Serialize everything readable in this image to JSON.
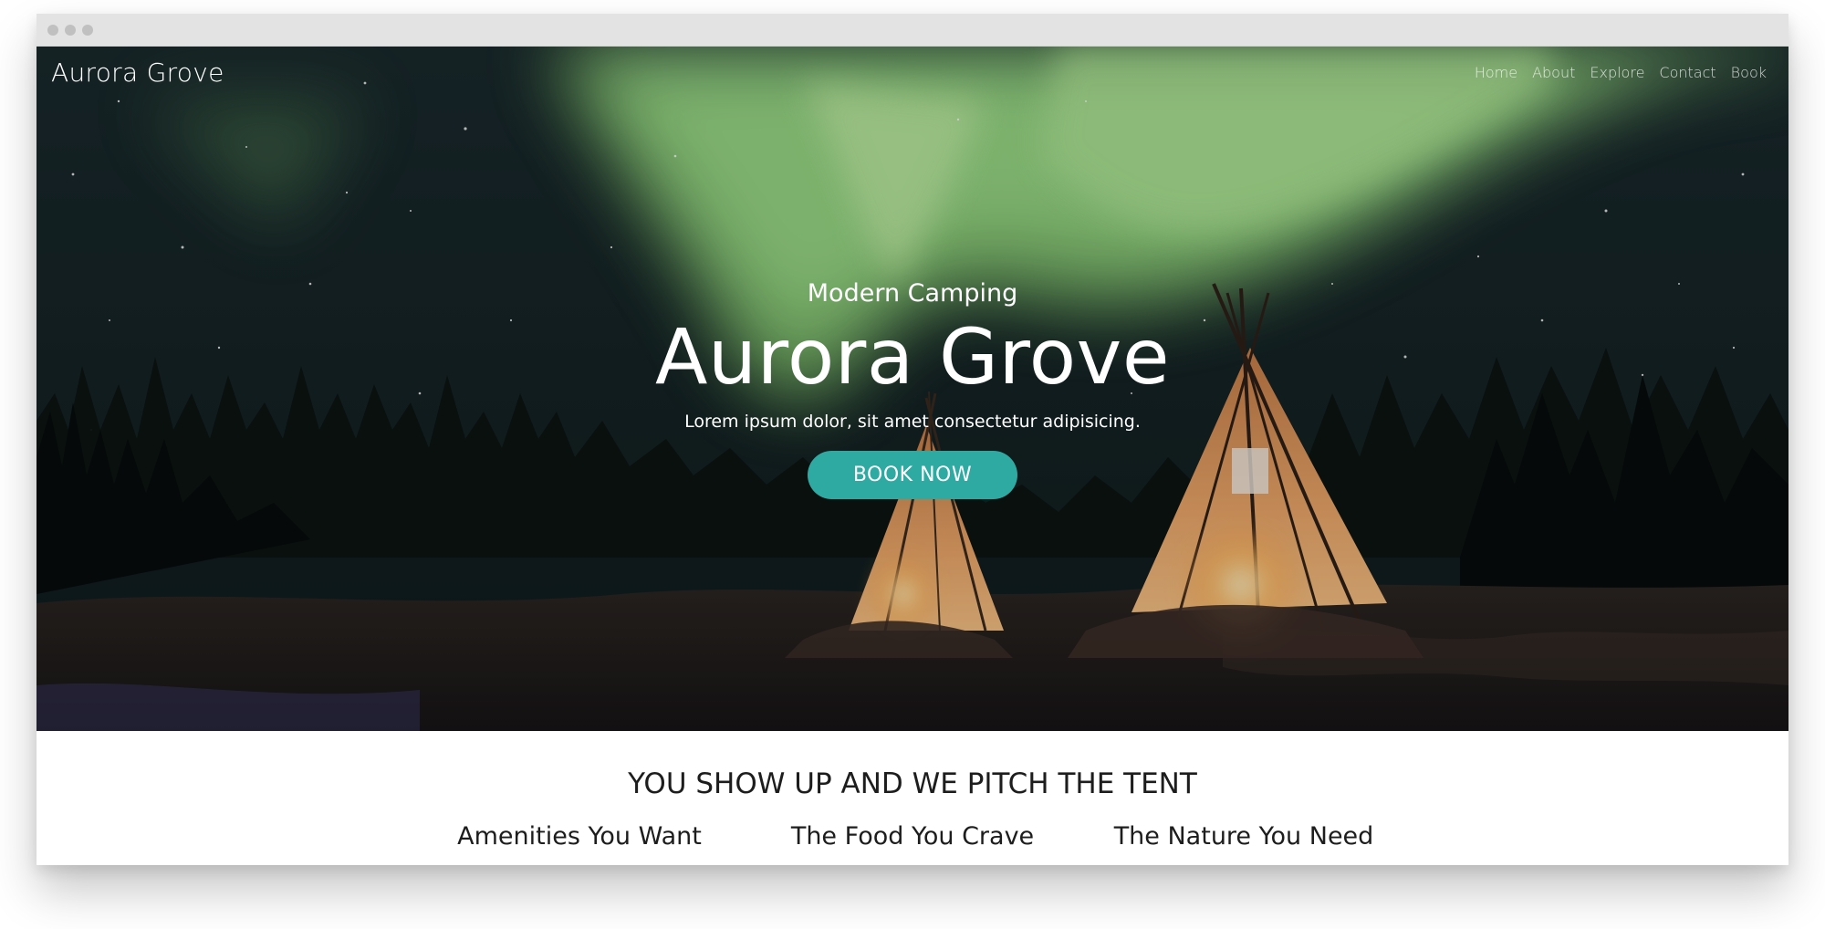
{
  "site": {
    "brand": "Aurora Grove",
    "nav": [
      "Home",
      "About",
      "Explore",
      "Contact",
      "Book"
    ]
  },
  "hero": {
    "subtitle": "Modern Camping",
    "headline": "Aurora Grove",
    "tagline": "Lorem ipsum dolor, sit amet consectetur adipisicing.",
    "cta_label": "BOOK NOW"
  },
  "section": {
    "title": "YOU SHOW UP AND WE PITCH THE TENT",
    "features": [
      "Amenities You Want",
      "The Food You Crave",
      "The Nature You Need"
    ]
  },
  "colors": {
    "accent": "#2eaaa2",
    "aurora": "#8fd27a",
    "night_sky": "#0c1a1c",
    "window_chrome": "#e3e3e3"
  },
  "icons": {
    "window_controls": "traffic-light-dots"
  }
}
